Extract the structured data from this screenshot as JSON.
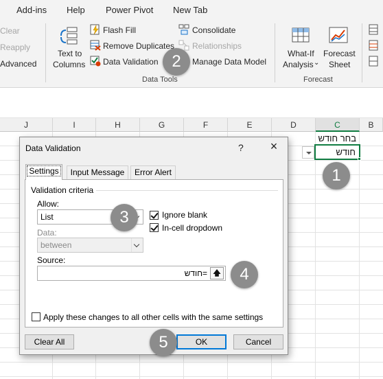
{
  "ribbon_tabs": [
    "Add-ins",
    "Help",
    "Power Pivot",
    "New Tab"
  ],
  "sort_filter": {
    "clear": "Clear",
    "reapply": "Reapply",
    "advanced": "Advanced"
  },
  "data_tools": {
    "text_to_columns_1": "Text to",
    "text_to_columns_2": "Columns",
    "flash_fill": "Flash Fill",
    "remove_duplicates": "Remove Duplicates",
    "data_validation": "Data Validation",
    "consolidate": "Consolidate",
    "relationships": "Relationships",
    "manage_data_model": "Manage Data Model",
    "group_label": "Data Tools"
  },
  "forecast": {
    "what_if_1": "What-If",
    "what_if_2": "Analysis",
    "forecast_sheet_1": "Forecast",
    "forecast_sheet_2": "Sheet",
    "group_label": "Forecast"
  },
  "columns": [
    "J",
    "I",
    "H",
    "G",
    "F",
    "E",
    "D",
    "C",
    "B"
  ],
  "cells": {
    "c1": "בחר חודש",
    "c2": "חודש"
  },
  "badges": [
    "1",
    "2",
    "3",
    "4",
    "5"
  ],
  "dialog": {
    "title": "Data Validation",
    "help": "?",
    "tabs": [
      "Settings",
      "Input Message",
      "Error Alert"
    ],
    "criteria_title": "Validation criteria",
    "allow_label": "Allow:",
    "allow_value": "List",
    "ignore_blank": "Ignore blank",
    "ignore_blank_checked": true,
    "incell_dropdown": "In-cell dropdown",
    "incell_dropdown_checked": true,
    "data_label": "Data:",
    "data_value": "between",
    "source_label": "Source:",
    "source_value": "=חודש",
    "apply_all": "Apply these changes to all other cells with the same settings",
    "apply_all_checked": false,
    "clear_all": "Clear All",
    "ok": "OK",
    "cancel": "Cancel"
  }
}
